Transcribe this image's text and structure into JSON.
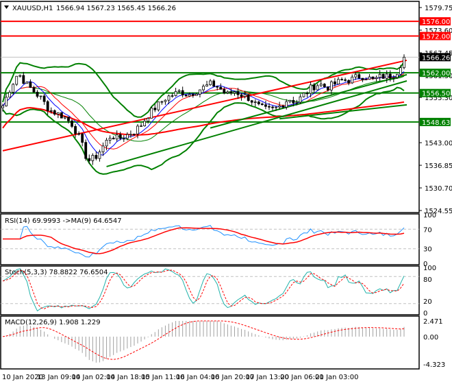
{
  "header": {
    "symbol": "XAUUSD,H1",
    "ohlc": "1566.94 1567.23 1565.45 1566.26"
  },
  "chart_data": {
    "type": "candlestick",
    "title": "XAUUSD,H1",
    "ylim": [
      1524.55,
      1579.75
    ],
    "price_ticks": [
      "1579.75",
      "1573.60",
      "1567.45",
      "1561.30",
      "1555.30",
      "1543.00",
      "1536.85",
      "1530.70",
      "1524.55"
    ],
    "key_closes": [
      1553,
      1558,
      1562,
      1559,
      1557,
      1555,
      1552,
      1551,
      1550,
      1548,
      1544,
      1538,
      1539,
      1542,
      1545,
      1544,
      1545,
      1546,
      1548,
      1551,
      1553,
      1555,
      1556,
      1557,
      1556,
      1557,
      1558,
      1559,
      1558,
      1556,
      1557,
      1556,
      1555,
      1553,
      1552,
      1552,
      1553,
      1555,
      1554,
      1556,
      1558,
      1559,
      1558,
      1559,
      1560,
      1560,
      1561,
      1561,
      1560,
      1561,
      1561,
      1562,
      1566.26
    ],
    "bar_count": 117,
    "levels": [
      {
        "price": 1576.0,
        "label": "1576.00",
        "color": "#ff0000"
      },
      {
        "price": 1572.0,
        "label": "1572.00",
        "color": "#ff0000"
      },
      {
        "price": 1562.0,
        "label": "1562.00",
        "color": "#008000"
      },
      {
        "price": 1556.5,
        "label": "1556.50",
        "color": "#008000"
      },
      {
        "price": 1548.63,
        "label": "1548.63",
        "color": "#008000"
      }
    ],
    "current_price": {
      "price": 1566.26,
      "label": "1566.26"
    },
    "trendlines": [
      {
        "from": [
          0,
          1540.8
        ],
        "to": [
          117,
          1565.4
        ],
        "color": "#ff0000"
      },
      {
        "from": [
          30,
          1536.5
        ],
        "to": [
          117,
          1559.8
        ],
        "color": "#008000"
      },
      {
        "from": [
          60,
          1547.0
        ],
        "to": [
          117,
          1561.5
        ],
        "color": "#008000"
      },
      {
        "from": [
          80,
          1549.5
        ],
        "to": [
          117,
          1553.3
        ],
        "color": "#008000"
      }
    ],
    "time_labels": [
      "10 Jan 2020",
      "13 Jan 09:00",
      "14 Jan 02:00",
      "14 Jan 18:00",
      "15 Jan 11:00",
      "16 Jan 04:00",
      "16 Jan 20:00",
      "17 Jan 13:00",
      "20 Jan 06:00",
      "21 Jan 03:00"
    ],
    "rsi": {
      "label": "RSI(14) 69.9993  ->MA(9) 64.6547",
      "ticks": [
        "100",
        "70",
        "30",
        "0"
      ]
    },
    "stoch": {
      "label": "Stoch(5,3,3) 78.8822 76.6504",
      "ticks": [
        "100",
        "80",
        "20",
        "0"
      ]
    },
    "macd": {
      "label": "MACD(12,26,9) 1.908 1.229",
      "ticks": [
        "2.471",
        "0.00",
        "-4.323"
      ],
      "range": [
        -4.323,
        2.471
      ]
    }
  },
  "colors": {
    "bull": "#008000",
    "bear": "#000000",
    "ma_red": "#ff0000",
    "ma_blue": "#0000ff",
    "rsi": "#1e90ff",
    "stoch": "#20b2aa"
  }
}
